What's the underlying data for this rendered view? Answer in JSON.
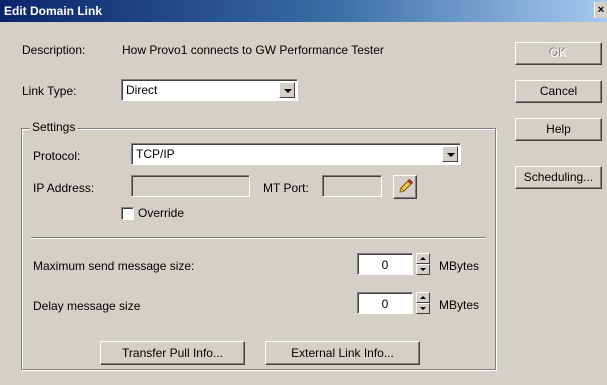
{
  "window": {
    "title": "Edit Domain Link",
    "close_glyph": "×"
  },
  "form": {
    "description_label": "Description:",
    "description_value": "How Provo1 connects to GW Performance Tester",
    "link_type_label": "Link Type:",
    "link_type_value": "Direct"
  },
  "settings": {
    "group_label": "Settings",
    "protocol_label": "Protocol:",
    "protocol_value": "TCP/IP",
    "ip_label": "IP Address:",
    "ip_value": "",
    "mt_port_label": "MT Port:",
    "mt_port_value": "",
    "override_label": "Override",
    "override_checked": false,
    "max_send_label": "Maximum send message size:",
    "max_send_value": "0",
    "max_send_unit": "MBytes",
    "delay_label": "Delay message size",
    "delay_value": "0",
    "delay_unit": "MBytes",
    "transfer_pull_label": "Transfer Pull Info...",
    "external_link_label": "External Link Info..."
  },
  "buttons": {
    "ok": "OK",
    "cancel": "Cancel",
    "help": "Help",
    "scheduling": "Scheduling..."
  },
  "colors": {
    "title_start": "#0a246a",
    "title_end": "#a6caf0",
    "face": "#d4d0c8"
  },
  "icons": {
    "edit": "pencil-icon"
  }
}
